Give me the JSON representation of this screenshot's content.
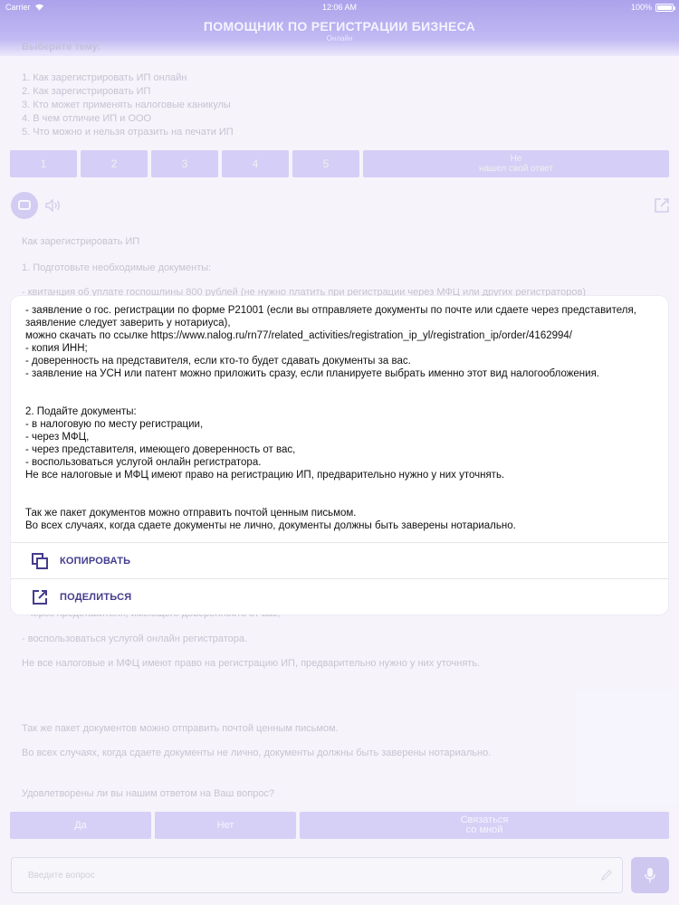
{
  "status_bar": {
    "carrier": "Carrier",
    "time": "12:06 AM",
    "battery": "100%"
  },
  "header": {
    "title": "ПОМОЩНИК ПО РЕГИСТРАЦИИ БИЗНЕСА",
    "subtitle": "Онлайн"
  },
  "topics": {
    "heading": "Выберите тему:",
    "items": [
      "1. Как зарегистрировать ИП онлайн",
      "2. Как зарегистрировать ИП",
      "3. Кто может применять налоговые каникулы",
      "4. В чем отличие ИП и ООО",
      "5. Что можно и нельзя отразить на печати ИП"
    ]
  },
  "choices": [
    "1",
    "2",
    "3",
    "4",
    "5",
    "Не\nнашел свой ответ"
  ],
  "background_message": {
    "lines": [
      "Как зарегистрировать ИП",
      "1. Подготовьте необходимые документы:",
      "- квитанция об уплате госпошлины 800 рублей (не нужно платить при регистрации через МФЦ или других регистраторов)",
      "- через представителя, имеющего доверенность от вас,",
      "- воспользоваться услугой онлайн регистратора.",
      "Не все налоговые и МФЦ имеют право на регистрацию ИП, предварительно нужно у них уточнять.",
      "Так же пакет документов можно отправить почтой ценным письмом.",
      "Во всех случаях, когда сдаете документы не лично, документы должны быть заверены нотариально.",
      "Удовлетворены ли вы нашим ответом на Ваш вопрос?"
    ]
  },
  "feedback": {
    "yes": "Да",
    "no": "Нет",
    "contact": "Связаться\nсо мной"
  },
  "input": {
    "placeholder": "Введите вопрос"
  },
  "sheet": {
    "text": "- заявление о гос. регистрации по форме Р21001 (если вы отправляете документы по почте или сдаете через представителя, заявление следует заверить у нотариуса),\nможно скачать по ссылке https://www.nalog.ru/rn77/related_activities/registration_ip_yl/registration_ip/order/4162994/\n- копия ИНН;\n- доверенность на представителя, если кто-то будет сдавать документы за вас.\n- заявление на УСН или патент можно приложить сразу, если планируете выбрать именно этот вид налогообложения.\n\n\n2. Подайте документы:\n- в налоговую по месту регистрации,\n- через МФЦ,\n- через представителя, имеющего доверенность от вас,\n- воспользоваться услугой онлайн регистратора.\nНе все налоговые и МФЦ имеют право на регистрацию ИП, предварительно нужно у них уточнять.\n\n\nТак же пакет документов можно отправить почтой ценным письмом.\nВо всех случаях, когда сдаете документы не лично, документы должны быть заверены нотариально.",
    "copy_label": "КОПИРОВАТЬ",
    "share_label": "ПОДЕЛИТЬСЯ"
  },
  "colors": {
    "accent": "#443c8c",
    "header": "#9a8ee8",
    "button": "#ccc4f4"
  }
}
